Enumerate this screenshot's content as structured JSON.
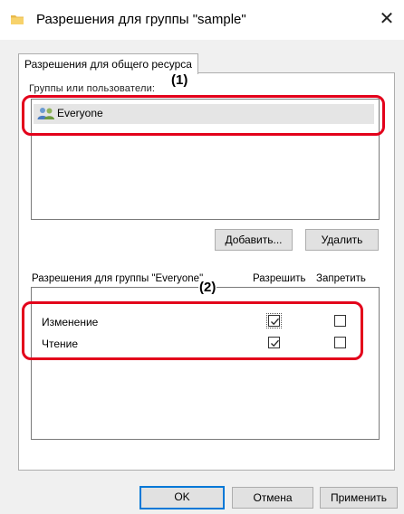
{
  "window": {
    "title": "Разрешения для группы \"sample\"",
    "icon": "folder-icon",
    "close_icon": "close-icon",
    "close_glyph": "✕"
  },
  "tab": {
    "label": "Разрешения для общего ресурса"
  },
  "groups": {
    "label": "Группы или пользователи:",
    "items": [
      {
        "name": "Everyone",
        "icon": "users-icon",
        "selected": true
      }
    ]
  },
  "group_buttons": {
    "add": "Добавить...",
    "remove": "Удалить"
  },
  "permissions": {
    "header_label": "Разрешения для группы \"Everyone\"",
    "allow_label": "Разрешить",
    "deny_label": "Запретить",
    "items": [
      {
        "label": "Изменение",
        "allow": true,
        "deny": false
      },
      {
        "label": "Чтение",
        "allow": true,
        "deny": false
      }
    ]
  },
  "dialog_buttons": {
    "ok": "OK",
    "cancel": "Отмена",
    "apply": "Применить"
  },
  "callouts": {
    "one": "(1)",
    "two": "(2)"
  },
  "colors": {
    "accent": "#0078d7",
    "callout": "#e3001b",
    "selection": "#e5e5e5",
    "dialog_bg": "#f0f0f0"
  }
}
